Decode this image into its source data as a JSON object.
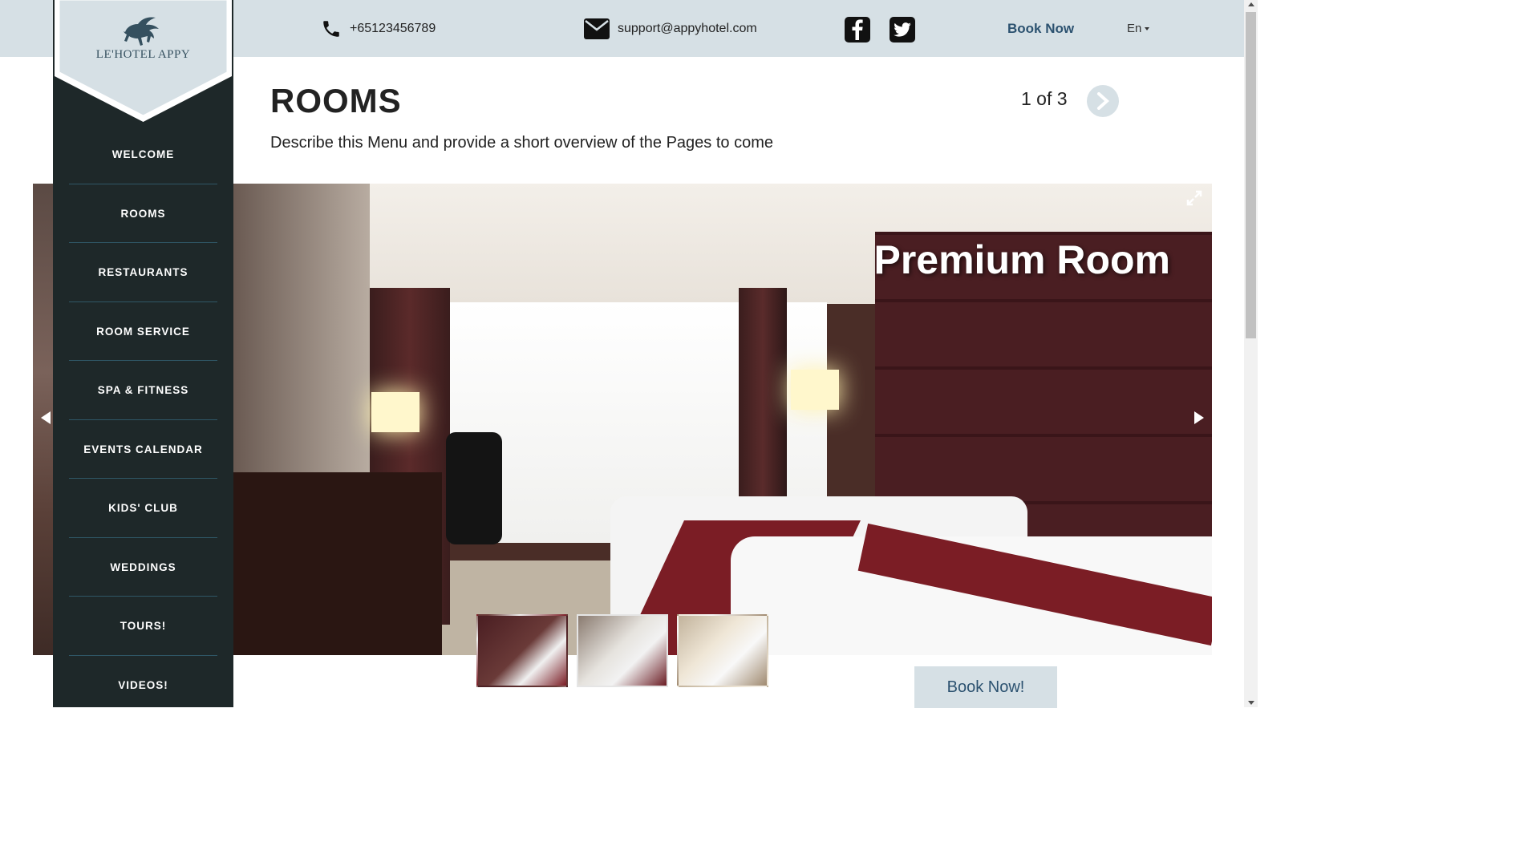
{
  "header": {
    "phone": "+65123456789",
    "email": "support@appyhotel.com",
    "book_now": "Book Now",
    "language": "En"
  },
  "logo": {
    "text": "LE'HOTEL APPY"
  },
  "sidebar": {
    "items": [
      {
        "label": "WELCOME"
      },
      {
        "label": "ROOMS"
      },
      {
        "label": "RESTAURANTS"
      },
      {
        "label": "ROOM SERVICE"
      },
      {
        "label": "SPA & FITNESS"
      },
      {
        "label": "EVENTS CALENDAR"
      },
      {
        "label": "KIDS' CLUB"
      },
      {
        "label": "WEDDINGS"
      },
      {
        "label": "TOURS!"
      },
      {
        "label": "VIDEOS!"
      }
    ]
  },
  "main": {
    "title": "ROOMS",
    "description": "Describe this Menu and provide a short overview of the Pages to come",
    "pager": "1 of 3"
  },
  "slideshow": {
    "current_title": "Premium Room",
    "thumbnails_count": 3,
    "active_thumbnail": 2
  },
  "cta": {
    "book_label": "Book Now!"
  },
  "icons": {
    "phone": "phone-icon",
    "email": "envelope-icon",
    "facebook": "facebook-icon",
    "twitter": "twitter-icon",
    "next": "chevron-right-icon",
    "expand": "expand-icon"
  },
  "colors": {
    "topbar_bg": "#d6e0e5",
    "sidebar_bg": "#1e2829",
    "accent": "#2c5270"
  }
}
